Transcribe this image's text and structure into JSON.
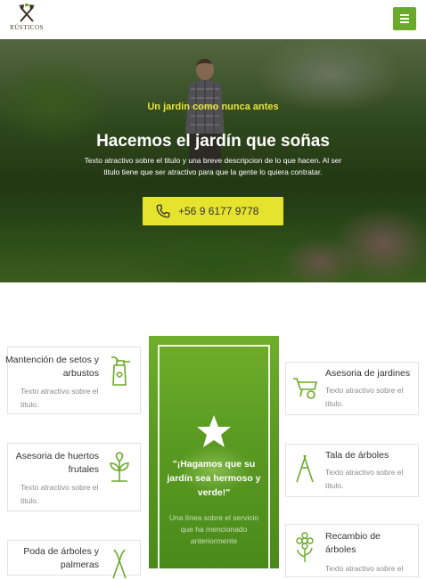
{
  "header": {
    "logo_text": "RÚSTICOS",
    "menu_icon": "hamburger-icon",
    "accent": "#6aaa2a"
  },
  "hero": {
    "tagline": "Un jardin como nunca antes",
    "title": "Hacemos el jardín que soñas",
    "description": "Texto atractivo sobre el titulo y una breve descripcion de lo que hacen. Al ser titulo tiene que ser atractivo para que la gente lo quiera contratar.",
    "phone": "+56 9 6177 9778",
    "phone_icon": "phone-icon",
    "tagline_color": "#e8e53a",
    "button_color": "#e5e32e"
  },
  "services_left": [
    {
      "title": "Mantención de setos y arbustos",
      "desc": "Texto atractivo sobre el titulo.",
      "icon": "spray-bottle-icon"
    },
    {
      "title": "Asesoria de huertos frutales",
      "desc": "Texto atractivo sobre el titulo.",
      "icon": "sprout-icon"
    },
    {
      "title": "Poda de árboles y palmeras",
      "desc": "",
      "icon": "shears-icon"
    }
  ],
  "services_right": [
    {
      "title": "Asesoria de jardines",
      "desc": "Texto atractivo sobre el titulo.",
      "icon": "wheelbarrow-icon"
    },
    {
      "title": "Tala de árboles",
      "desc": "Texto atractivo sobre el titulo.",
      "icon": "pruning-shears-icon"
    },
    {
      "title": "Recambio de árboles",
      "desc": "Texto atractivo sobre el",
      "icon": "flower-icon"
    }
  ],
  "promo": {
    "title": "\"¡Hagamos que su jardín sea hermoso y verde!\"",
    "subtitle": "Una línea sobre el servicio que ha mencionado anteriormente",
    "icon": "star-icon"
  }
}
